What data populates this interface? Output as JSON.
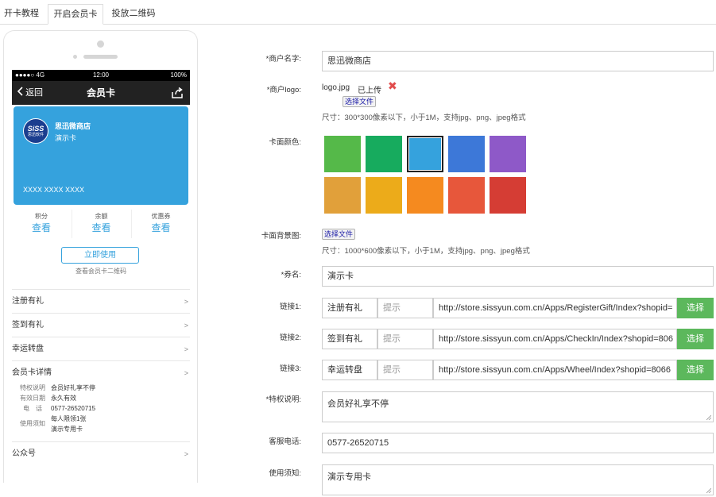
{
  "tabs": [
    "开卡教程",
    "开启会员卡",
    "投放二维码"
  ],
  "phone": {
    "status": {
      "signal": "●●●●○ 4G",
      "time": "12:00",
      "battery": "100%"
    },
    "nav": {
      "back": "返回",
      "title": "会员卡"
    },
    "card": {
      "logo_text": "SiSS",
      "logo_subtext": "思迅软件",
      "name": "思迅微商店",
      "type": "演示卡",
      "number": "XXXX XXXX XXXX",
      "color": "#35a2dd"
    },
    "stats": [
      {
        "label": "积分",
        "link": "查看"
      },
      {
        "label": "余额",
        "link": "查看"
      },
      {
        "label": "优惠券",
        "link": "查看"
      }
    ],
    "use_button": "立即使用",
    "qr_link": "查看会员卡二维码",
    "menu": [
      {
        "label": "注册有礼",
        "arrow": ">"
      },
      {
        "label": "签到有礼",
        "arrow": ">"
      },
      {
        "label": "幸运转盘",
        "arrow": ">"
      },
      {
        "label": "会员卡详情",
        "arrow": ">"
      },
      {
        "label": "公众号",
        "arrow": ">"
      }
    ],
    "details": [
      {
        "key": "特权说明",
        "value": "会员好礼享不停"
      },
      {
        "key": "有效日期",
        "value": "永久有效"
      },
      {
        "key": "电　话",
        "value": "0577-26520715"
      },
      {
        "key": "使用须知",
        "value": "每人限领1张",
        "value2": "演示专用卡"
      }
    ]
  },
  "form": {
    "merchant_name": {
      "label": "*商户名字:",
      "value": "思迅微商店"
    },
    "merchant_logo": {
      "label": "*商户logo:",
      "file": "logo.jpg",
      "status": "已上传",
      "delete_icon": "✖",
      "choose": "选择文件",
      "hint": "尺寸：300*300像素以下，小于1M，支持jpg、png、jpeg格式"
    },
    "card_color": {
      "label": "卡面颜色:",
      "colors": [
        "#55b949",
        "#17ab5e",
        "#35a2dd",
        "#3d78d8",
        "#8e59c8",
        "#e1a03a",
        "#ecab1a",
        "#f58a1f",
        "#e7573b",
        "#d53d34"
      ],
      "selected": 2
    },
    "card_bg": {
      "label": "卡面背景图:",
      "choose": "选择文件",
      "hint": "尺寸：1000*600像素以下，小于1M，支持jpg、png、jpeg格式"
    },
    "coupon_name": {
      "label": "*券名:",
      "value": "演示卡"
    },
    "links": [
      {
        "label": "链接1:",
        "name": "注册有礼",
        "hint_placeholder": "提示",
        "url": "http://store.sissyun.com.cn/Apps/RegisterGift/Index?shopid=",
        "button": "选择"
      },
      {
        "label": "链接2:",
        "name": "签到有礼",
        "hint_placeholder": "提示",
        "url": "http://store.sissyun.com.cn/Apps/CheckIn/Index?shopid=806",
        "button": "选择"
      },
      {
        "label": "链接3:",
        "name": "幸运转盘",
        "hint_placeholder": "提示",
        "url": "http://store.sissyun.com.cn/Apps/Wheel/Index?shopid=8066",
        "button": "选择"
      }
    ],
    "privilege": {
      "label": "*特权说明:",
      "value": "会员好礼享不停"
    },
    "phone": {
      "label": "客服电话:",
      "value": "0577-26520715"
    },
    "notice": {
      "label": "使用须知:",
      "value": "演示专用卡"
    }
  }
}
